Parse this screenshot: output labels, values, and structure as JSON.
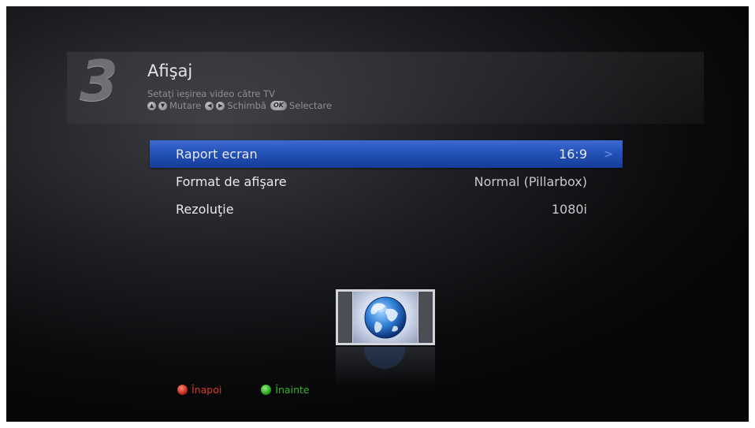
{
  "header": {
    "step_number": "3",
    "title": "Afişaj",
    "subtitle": "Setaţi ieşirea video către TV",
    "hints": {
      "move_label": "Mutare",
      "change_label": "Schimbă",
      "ok_badge": "OK",
      "select_label": "Selectare"
    }
  },
  "menu": {
    "items": [
      {
        "label": "Raport ecran",
        "value": "16:9",
        "selected": true
      },
      {
        "label": "Format de afişare",
        "value": "Normal (Pillarbox)",
        "selected": false
      },
      {
        "label": "Rezoluţie",
        "value": "1080i",
        "selected": false
      }
    ]
  },
  "footer": {
    "back_label": "Înapoi",
    "forward_label": "Înainte"
  },
  "colors": {
    "selection": "#2452b8",
    "red_button": "#c4281a",
    "green_button": "#2ea51d"
  }
}
